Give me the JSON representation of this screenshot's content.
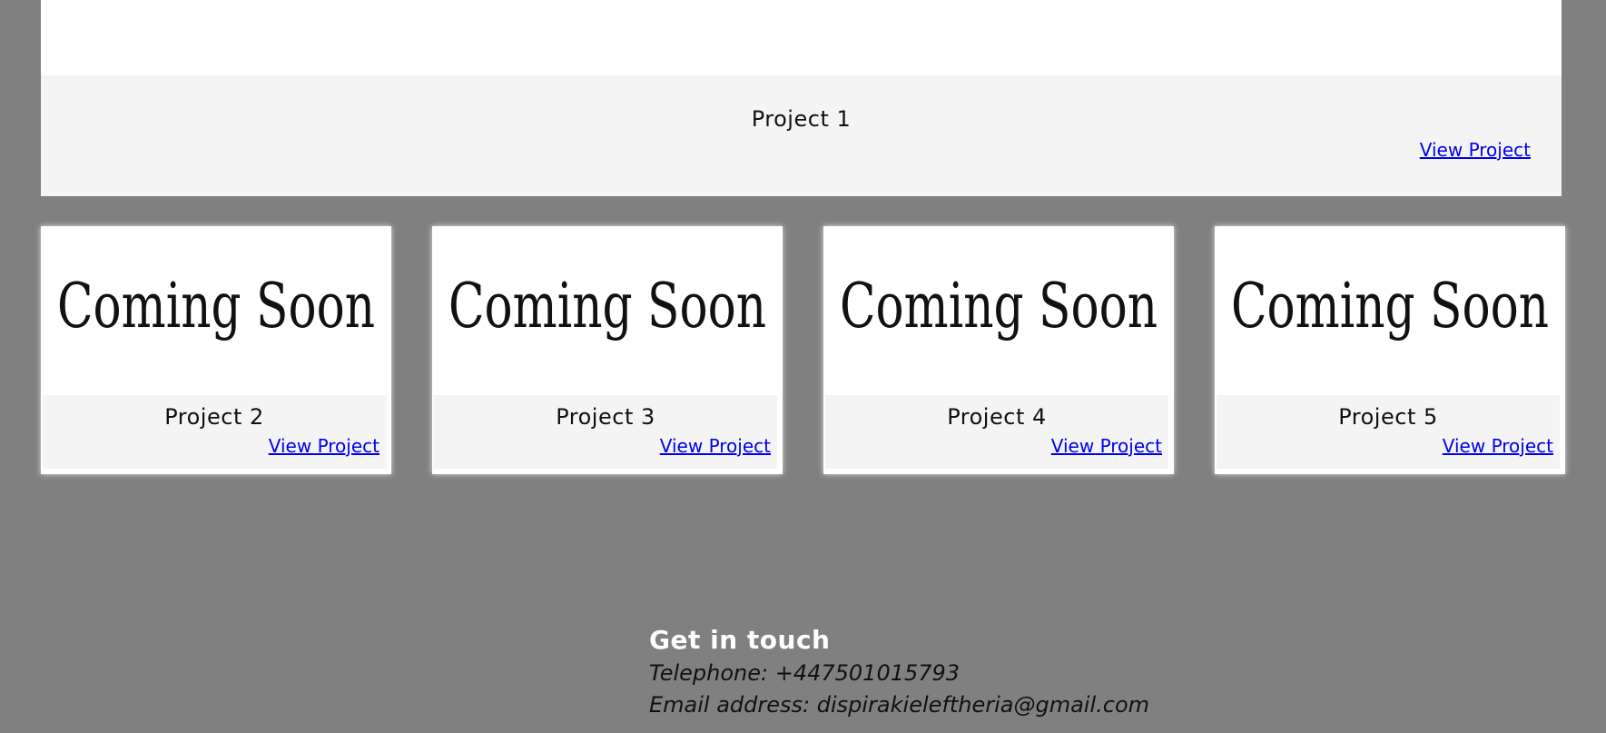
{
  "projects": [
    {
      "title": "Project 1",
      "link_label": "View Project"
    },
    {
      "title": "Project 2",
      "link_label": "View Project",
      "image_text": "Coming Soon"
    },
    {
      "title": "Project 3",
      "link_label": "View Project",
      "image_text": "Coming Soon"
    },
    {
      "title": "Project 4",
      "link_label": "View Project",
      "image_text": "Coming Soon"
    },
    {
      "title": "Project 5",
      "link_label": "View Project",
      "image_text": "Coming Soon"
    }
  ],
  "contact": {
    "heading": "Get in touch",
    "telephone": "Telephone: +447501015793",
    "email": "Email address: dispirakieleftheria@gmail.com"
  },
  "colors": {
    "page_background": "#808080",
    "card_background": "#ffffff",
    "caption_background": "#f4f4f4",
    "link": "#0000ee"
  }
}
